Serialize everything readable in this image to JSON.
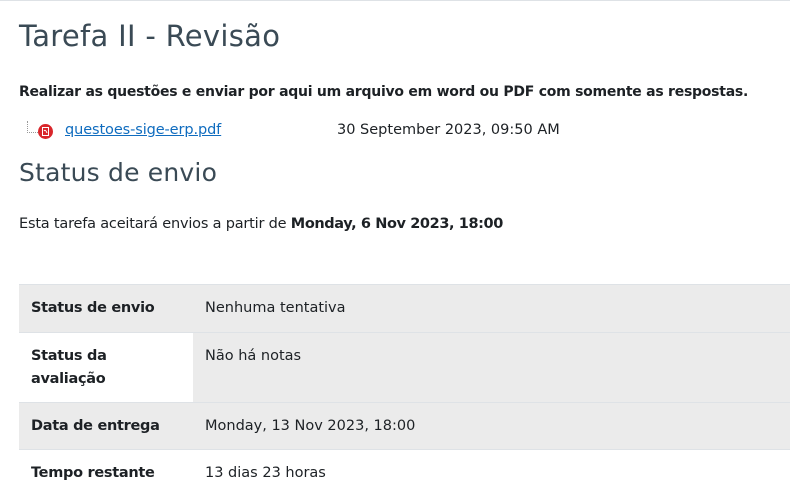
{
  "assignment": {
    "title": "Tarefa II - Revisão",
    "intro": "Realizar as questões e enviar por aqui um arquivo em word ou PDF com somente as respostas.",
    "file": {
      "name": "questoes-sige-erp.pdf",
      "date": "30 September 2023, 09:50 AM",
      "icon": "pdf-icon",
      "icon_color": "#d9262b"
    }
  },
  "submission": {
    "section_title": "Status de envio",
    "open_text_prefix": "Esta tarefa aceitará envios a partir de ",
    "open_date": "Monday, 6 Nov 2023, 18:00",
    "rows": [
      {
        "label": "Status de envio",
        "value": "Nenhuma tentativa"
      },
      {
        "label": "Status da avaliação",
        "value": "Não há notas"
      },
      {
        "label": "Data de entrega",
        "value": "Monday, 13 Nov 2023, 18:00"
      },
      {
        "label": "Tempo restante",
        "value": "13 dias 23 horas"
      }
    ]
  },
  "colors": {
    "link": "#0f6cbf",
    "heading": "#3a4a55",
    "row_shade": "#ebebeb"
  }
}
